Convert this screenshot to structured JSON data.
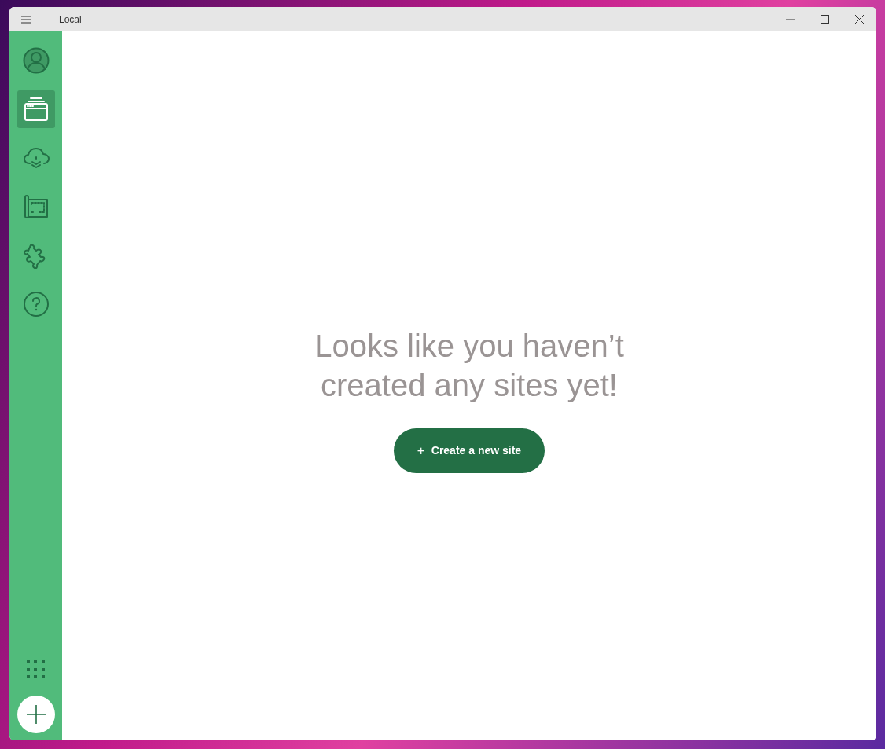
{
  "window": {
    "title": "Local"
  },
  "sidebar": {
    "items": [
      {
        "kind": "user",
        "selected": false
      },
      {
        "kind": "sites",
        "selected": true
      },
      {
        "kind": "cloud",
        "selected": false
      },
      {
        "kind": "blueprint",
        "selected": false
      },
      {
        "kind": "addons",
        "selected": false
      },
      {
        "kind": "help",
        "selected": false
      }
    ]
  },
  "main": {
    "heading": "Looks like you haven’t created any sites yet!",
    "button": {
      "icon": "+",
      "label": "Create a new site"
    }
  }
}
